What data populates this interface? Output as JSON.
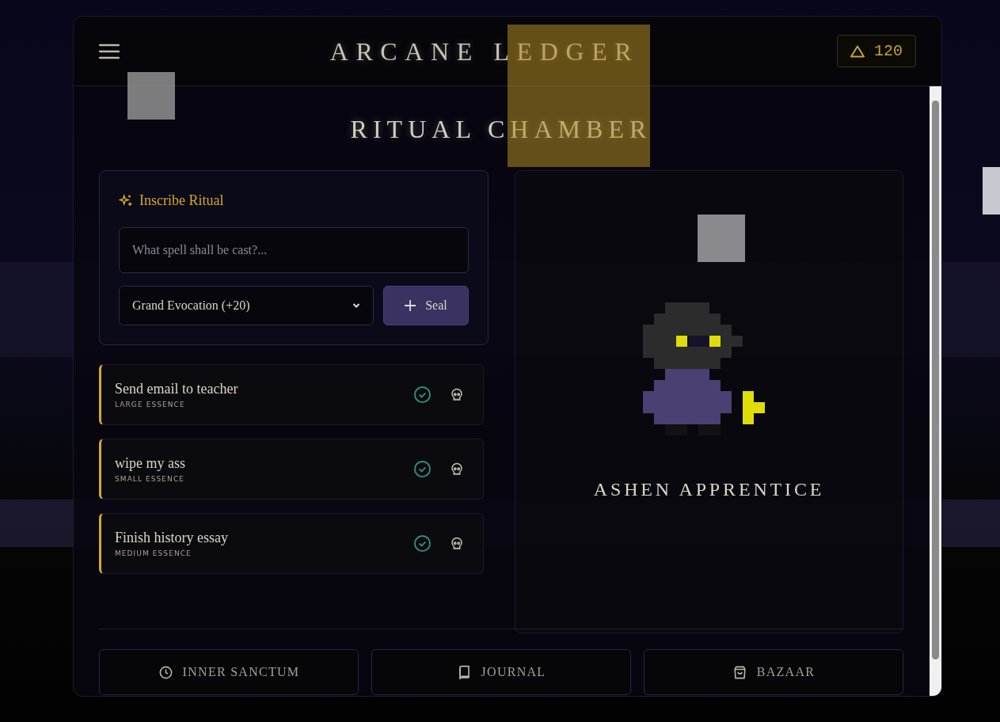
{
  "header": {
    "title": "ARCANE LEDGER",
    "currency": "120"
  },
  "page_title": "RITUAL CHAMBER",
  "form": {
    "heading": "Inscribe Ritual",
    "placeholder": "What spell shall be cast?...",
    "select_value": "Grand Evocation (+20)",
    "button": "Seal"
  },
  "quests": [
    {
      "title": "Send email to teacher",
      "essence": "LARGE ESSENCE"
    },
    {
      "title": "wipe my ass",
      "essence": "SMALL ESSENCE"
    },
    {
      "title": "Finish history essay",
      "essence": "MEDIUM ESSENCE"
    }
  ],
  "character": {
    "name": "ASHEN APPRENTICE"
  },
  "nav": [
    {
      "label": "INNER SANCTUM"
    },
    {
      "label": "JOURNAL"
    },
    {
      "label": "BAZAAR"
    }
  ]
}
